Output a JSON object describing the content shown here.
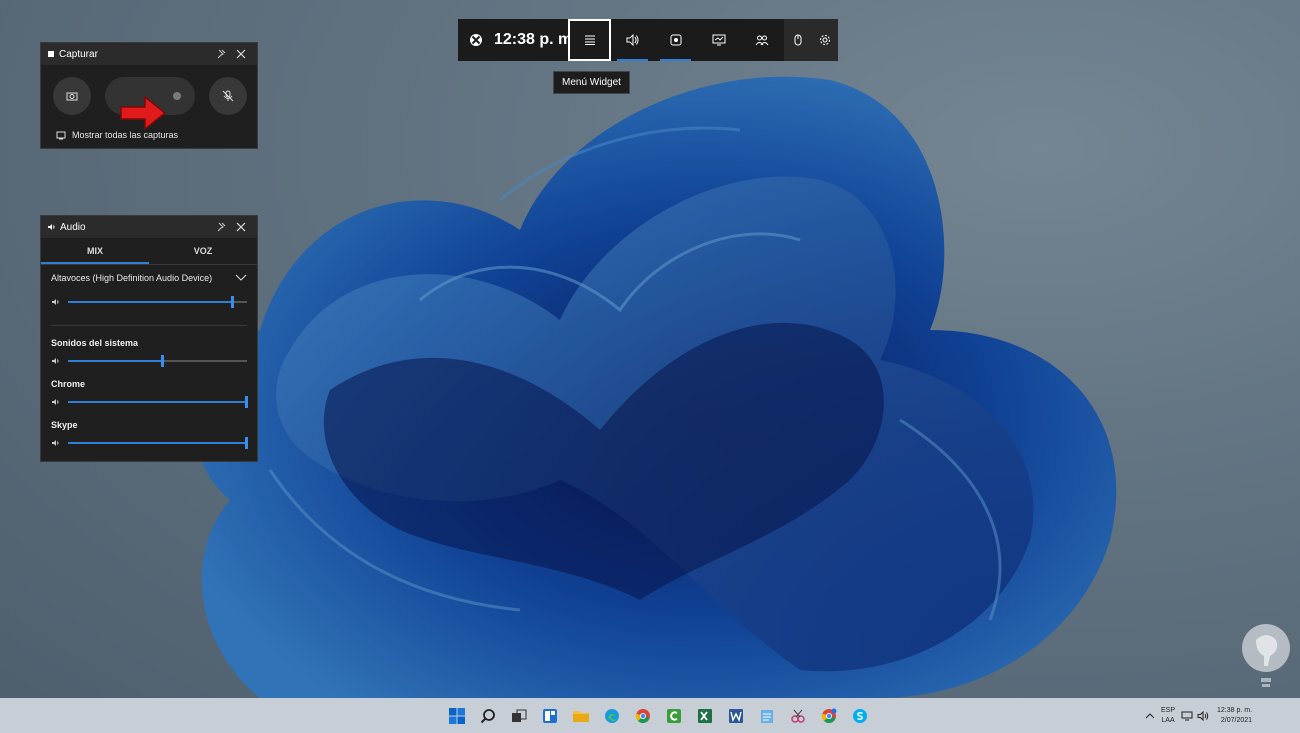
{
  "gamebar": {
    "time": "12:38 p. m.",
    "tooltip": "Menú Widget"
  },
  "capture_widget": {
    "title": "Capturar",
    "show_all": "Mostrar todas las capturas"
  },
  "audio_widget": {
    "title": "Audio",
    "tabs": [
      "MIX",
      "VOZ"
    ],
    "device": "Altavoces (High Definition Audio Device)",
    "master_level": 0.92,
    "apps": [
      {
        "label": "Sonidos del sistema",
        "level": 0.53
      },
      {
        "label": "Chrome",
        "level": 1.0
      },
      {
        "label": "Skype",
        "level": 1.0
      }
    ]
  },
  "tray": {
    "lang1": "ESP",
    "lang2": "LAA",
    "time": "12:38 p. m.",
    "date": "2/07/2021"
  },
  "colors": {
    "accent": "#2f7fd6",
    "panel": "#1f1f1f",
    "taskbar": "#c7ced6",
    "arrow": "#e11b1b"
  }
}
